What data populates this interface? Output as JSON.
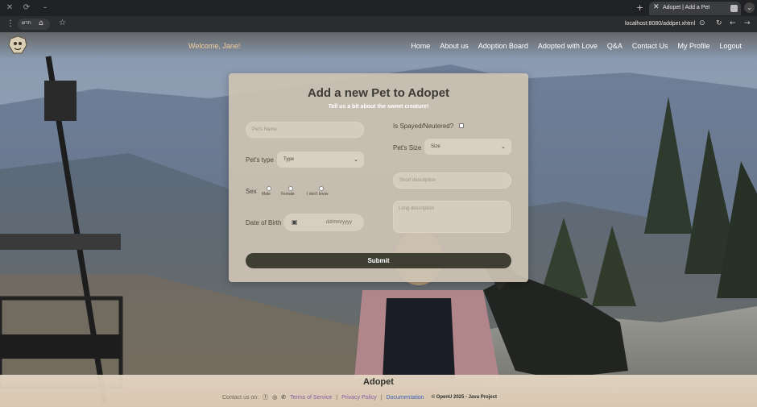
{
  "browser": {
    "tab_title": "Adopet | Add a Pet",
    "url": "localhost:8080/addpet.xhtml",
    "profile_label": "חדש"
  },
  "nav": {
    "welcome": "Welcome, Jane!",
    "links": [
      "Home",
      "About us",
      "Adoption Board",
      "Adopted with Love",
      "Q&A",
      "Contact Us",
      "My Profile",
      "Logout"
    ]
  },
  "form": {
    "title": "Add a new Pet to Adopet",
    "subtitle": "Tell us a bit about the sweet creature!",
    "pet_name_placeholder": "Pet's Name",
    "pet_type_label": "Pet's type",
    "pet_type_value": "Type",
    "sex_label": "Sex",
    "sex_options": [
      "Male",
      "Female",
      "I don't know"
    ],
    "dob_label": "Date of Birth",
    "dob_placeholder": "dd/mm/yyyy",
    "spayed_label": "Is Spayed/Neutered?",
    "pet_size_label": "Pet's Size",
    "pet_size_value": "Size",
    "short_desc_placeholder": "Short description",
    "long_desc_placeholder": "Long description",
    "submit_label": "Submit"
  },
  "footer": {
    "title": "Adopet",
    "contact_label": "Contact us on:",
    "terms": "Terms of Service",
    "privacy": "Privacy Policy",
    "docs": "Documentation",
    "copyright": "© OpenU 2025 - Java Project"
  },
  "icons": [
    "close-icon",
    "reload-icon",
    "minimize-icon",
    "new-tab-icon",
    "shield-icon",
    "chevron-down-icon",
    "menu-icon",
    "home-icon",
    "star-icon",
    "site-info-icon",
    "back-icon",
    "forward-icon",
    "calendar-icon",
    "facebook-icon",
    "instagram-icon",
    "whatsapp-icon",
    "logo-icon"
  ]
}
